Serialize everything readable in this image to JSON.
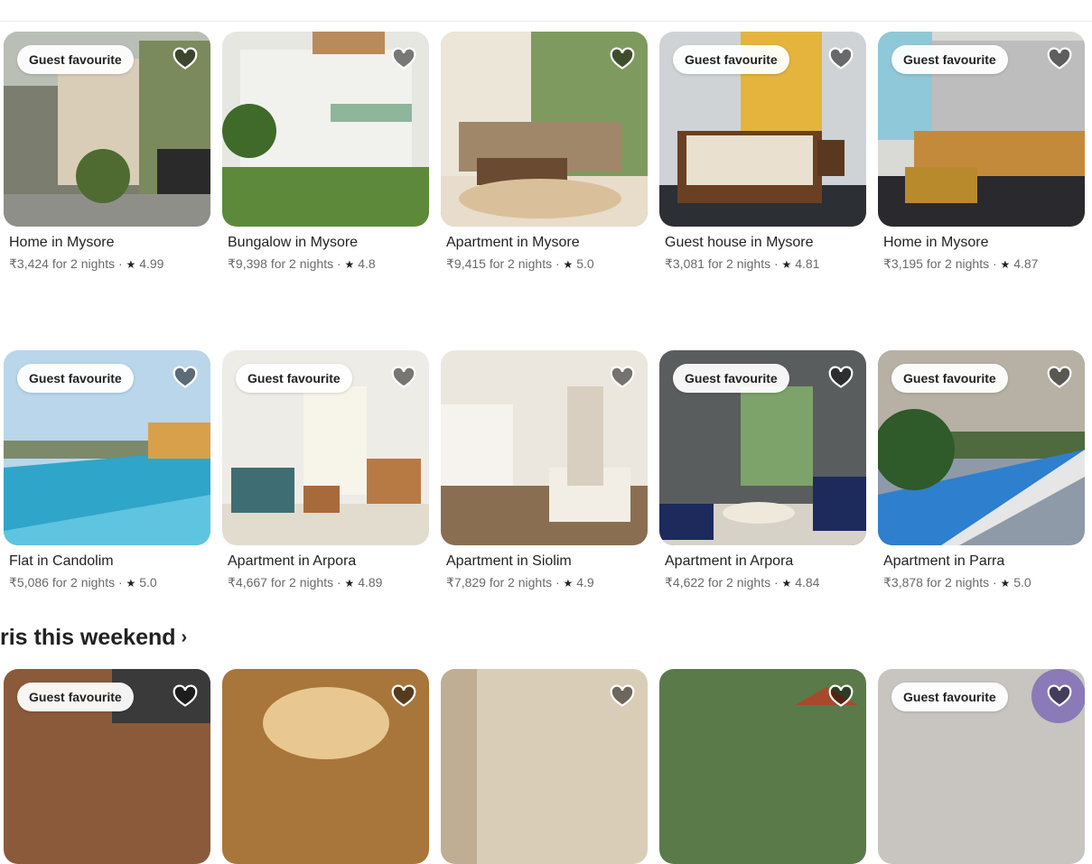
{
  "listings_row_1": [
    {
      "badge": "Guest favourite",
      "title": "Home in Mysore",
      "price": "₹3,424 for 2 nights",
      "rating": "4.99"
    },
    {
      "badge": "",
      "title": "Bungalow in Mysore",
      "price": "₹9,398 for 2 nights",
      "rating": "4.8"
    },
    {
      "badge": "",
      "title": "Apartment in Mysore",
      "price": "₹9,415 for 2 nights",
      "rating": "5.0"
    },
    {
      "badge": "Guest favourite",
      "title": "Guest house in Mysore",
      "price": "₹3,081 for 2 nights",
      "rating": "4.81"
    },
    {
      "badge": "Guest favourite",
      "title": "Home in Mysore",
      "price": "₹3,195 for 2 nights",
      "rating": "4.87"
    }
  ],
  "listings_row_2": [
    {
      "badge": "Guest favourite",
      "title": "Flat in Candolim",
      "price": "₹5,086 for 2 nights",
      "rating": "5.0"
    },
    {
      "badge": "Guest favourite",
      "title": "Apartment in Arpora",
      "price": "₹4,667 for 2 nights",
      "rating": "4.89"
    },
    {
      "badge": "",
      "title": "Apartment in Siolim",
      "price": "₹7,829 for 2 nights",
      "rating": "4.9"
    },
    {
      "badge": "Guest favourite",
      "title": "Apartment in Arpora",
      "price": "₹4,622 for 2 nights",
      "rating": "4.84"
    },
    {
      "badge": "Guest favourite",
      "title": "Apartment in Parra",
      "price": "₹3,878 for 2 nights",
      "rating": "5.0"
    }
  ],
  "section": {
    "title": "ris this weekend"
  },
  "listings_row_3": [
    {
      "badge": "Guest favourite"
    },
    {
      "badge": ""
    },
    {
      "badge": ""
    },
    {
      "badge": ""
    },
    {
      "badge": "Guest favourite"
    }
  ],
  "labels": {
    "separator": " · ",
    "star": "★"
  },
  "icons": {
    "heart": "heart-icon",
    "chevron": "chevron-right-icon"
  },
  "colors": {
    "text": "#222222",
    "muted": "#6a6a6a",
    "heart_fill": "rgba(0,0,0,0.5)"
  }
}
